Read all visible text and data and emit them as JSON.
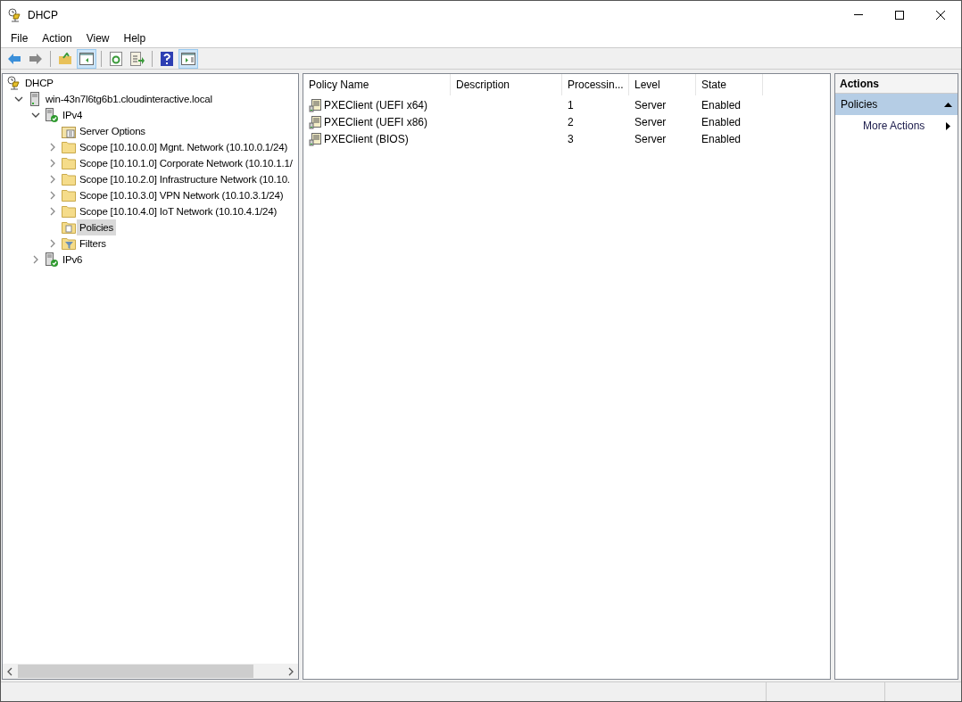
{
  "window": {
    "title": "DHCP"
  },
  "menu": [
    "File",
    "Action",
    "View",
    "Help"
  ],
  "toolbar": [
    {
      "kind": "back",
      "pressed": false
    },
    {
      "kind": "forward",
      "pressed": false
    },
    {
      "kind": "sep"
    },
    {
      "kind": "up",
      "pressed": false
    },
    {
      "kind": "tree",
      "pressed": true
    },
    {
      "kind": "sep"
    },
    {
      "kind": "refresh",
      "pressed": false
    },
    {
      "kind": "export",
      "pressed": false
    },
    {
      "kind": "sep"
    },
    {
      "kind": "help",
      "pressed": false
    },
    {
      "kind": "actions",
      "pressed": true
    }
  ],
  "tree": [
    {
      "label": "DHCP",
      "kind": "dhcp",
      "selected": false,
      "children": [
        {
          "label": "win-43n7l6tg6b1.cloudinteractive.local",
          "kind": "server",
          "expanded": true,
          "selected": false,
          "children": [
            {
              "label": "IPv4",
              "kind": "ip",
              "expanded": true,
              "selected": false,
              "children": [
                {
                  "label": "Server Options",
                  "kind": "options",
                  "selected": false
                },
                {
                  "label": "Scope [10.10.0.0] Mgnt. Network (10.10.0.1/24)",
                  "kind": "folder",
                  "expanded": false,
                  "selected": false
                },
                {
                  "label": "Scope [10.10.1.0] Corporate Network (10.10.1.1/",
                  "kind": "folder",
                  "expanded": false,
                  "selected": false
                },
                {
                  "label": "Scope [10.10.2.0] Infrastructure Network (10.10.",
                  "kind": "folder",
                  "expanded": false,
                  "selected": false
                },
                {
                  "label": "Scope [10.10.3.0] VPN Network (10.10.3.1/24)",
                  "kind": "folder",
                  "expanded": false,
                  "selected": false
                },
                {
                  "label": "Scope [10.10.4.0] IoT Network (10.10.4.1/24)",
                  "kind": "folder",
                  "expanded": false,
                  "selected": false
                },
                {
                  "label": "Policies",
                  "kind": "policy",
                  "selected": true
                },
                {
                  "label": "Filters",
                  "kind": "filter",
                  "expanded": false,
                  "selected": false
                }
              ]
            },
            {
              "label": "IPv6",
              "kind": "ip",
              "expanded": false,
              "selected": false
            }
          ]
        }
      ]
    }
  ],
  "table": {
    "columns": [
      "Policy Name",
      "Description",
      "Processin...",
      "Level",
      "State"
    ],
    "rows": [
      {
        "name": "PXEClient (UEFI x64)",
        "order": "1",
        "level": "Server",
        "state": "Enabled"
      },
      {
        "name": "PXEClient (UEFI x86)",
        "order": "2",
        "level": "Server",
        "state": "Enabled"
      },
      {
        "name": "PXEClient (BIOS)",
        "order": "3",
        "level": "Server",
        "state": "Enabled"
      }
    ]
  },
  "actions": {
    "title": "Actions",
    "section": "Policies",
    "items": [
      "More Actions"
    ]
  }
}
